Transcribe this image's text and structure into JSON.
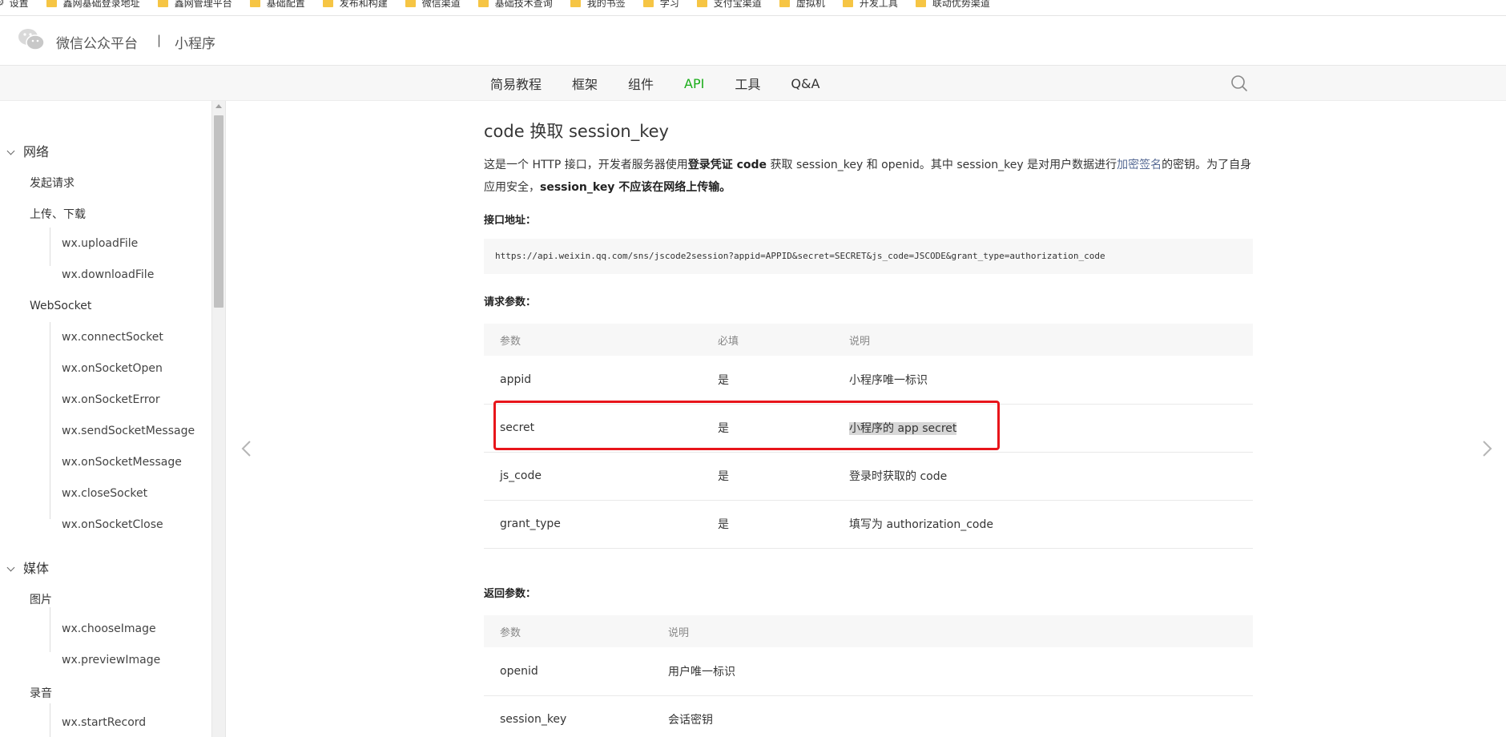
{
  "bookmarks": {
    "settings_label": "设置",
    "items": [
      "鑫网基础登录地址",
      "鑫网管理平台",
      "基础配置",
      "发布和构建",
      "微信渠道",
      "基础技术查询",
      "我的书签",
      "学习",
      "支付宝渠道",
      "虚拟机",
      "开发工具",
      "联动优势渠道"
    ]
  },
  "header": {
    "brand": "微信公众平台",
    "separator": "|",
    "sub": "小程序"
  },
  "nav": {
    "tabs": [
      {
        "label": "简易教程"
      },
      {
        "label": "框架"
      },
      {
        "label": "组件"
      },
      {
        "label": "API"
      },
      {
        "label": "工具"
      },
      {
        "label": "Q&A"
      }
    ],
    "active": "API"
  },
  "sidebar": {
    "network": "网络",
    "request": "发起请求",
    "upload_download": "上传、下载",
    "upload_file": "wx.uploadFile",
    "download_file": "wx.downloadFile",
    "websocket": "WebSocket",
    "connect_socket": "wx.connectSocket",
    "on_socket_open": "wx.onSocketOpen",
    "on_socket_error": "wx.onSocketError",
    "send_socket_message": "wx.sendSocketMessage",
    "on_socket_message": "wx.onSocketMessage",
    "close_socket": "wx.closeSocket",
    "on_socket_close": "wx.onSocketClose",
    "media": "媒体",
    "image": "图片",
    "choose_image": "wx.chooseImage",
    "preview_image": "wx.previewImage",
    "record": "录音",
    "start_record": "wx.startRecord"
  },
  "content": {
    "title": "code 换取 session_key",
    "intro": {
      "p1": "这是一个 HTTP 接口，开发者服务器使用",
      "b1": "登录凭证 code",
      "p2": " 获取 session_key 和 openid。其中 session_key 是对用户数据进行",
      "link": "加密签名",
      "p3": "的密钥。为了自身应用安全，",
      "b2": "session_key 不应该在网络上传输。"
    },
    "api_label": "接口地址：",
    "api_url": "https://api.weixin.qq.com/sns/jscode2session?appid=APPID&secret=SECRET&js_code=JSCODE&grant_type=authorization_code",
    "request_label": "请求参数：",
    "request_headers": {
      "param": "参数",
      "required": "必填",
      "desc": "说明"
    },
    "request_rows": [
      {
        "param": "appid",
        "required": "是",
        "desc": "小程序唯一标识"
      },
      {
        "param": "secret",
        "required": "是",
        "desc": "小程序的 app secret"
      },
      {
        "param": "js_code",
        "required": "是",
        "desc": "登录时获取的 code"
      },
      {
        "param": "grant_type",
        "required": "是",
        "desc": "填写为 authorization_code"
      }
    ],
    "response_label": "返回参数：",
    "response_headers": {
      "param": "参数",
      "desc": "说明"
    },
    "response_rows": [
      {
        "param": "openid",
        "desc": "用户唯一标识"
      },
      {
        "param": "session_key",
        "desc": "会话密钥"
      }
    ]
  },
  "colors": {
    "active_tab": "#1aad19",
    "link": "#576b95",
    "highlight_box": "#e8151b"
  }
}
